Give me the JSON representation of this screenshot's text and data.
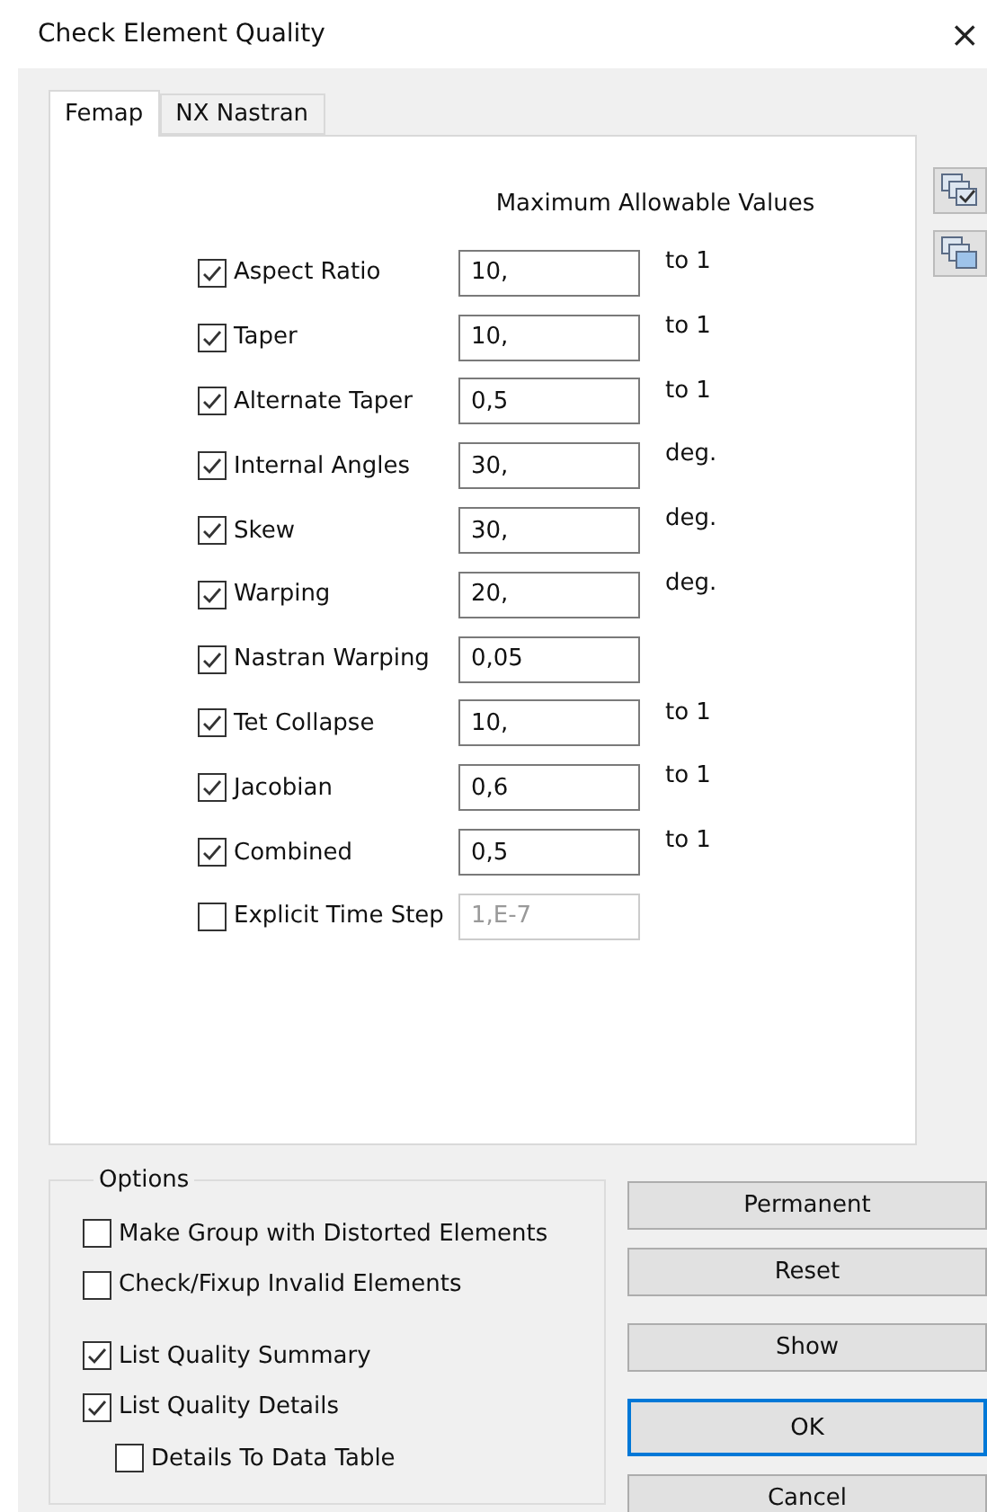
{
  "window": {
    "title": "Check Element Quality",
    "close": "×"
  },
  "tabs": [
    {
      "label": "Femap",
      "selected": true
    },
    {
      "label": "NX Nastran",
      "selected": false
    }
  ],
  "heading": "Maximum Allowable Values",
  "criteria": [
    {
      "label": "Aspect Ratio",
      "checked": true,
      "value": "10,",
      "unit": "to 1",
      "disabled": false
    },
    {
      "label": "Taper",
      "checked": true,
      "value": "10,",
      "unit": "to 1",
      "disabled": false
    },
    {
      "label": "Alternate Taper",
      "checked": true,
      "value": "0,5",
      "unit": "to 1",
      "disabled": false
    },
    {
      "label": "Internal Angles",
      "checked": true,
      "value": "30,",
      "unit": "deg.",
      "disabled": false
    },
    {
      "label": "Skew",
      "checked": true,
      "value": "30,",
      "unit": "deg.",
      "disabled": false
    },
    {
      "label": "Warping",
      "checked": true,
      "value": "20,",
      "unit": "deg.",
      "disabled": false
    },
    {
      "label": "Nastran Warping",
      "checked": true,
      "value": "0,05",
      "disabled": false
    },
    {
      "label": "Tet Collapse",
      "checked": true,
      "value": "10,",
      "unit": "to 1",
      "disabled": false
    },
    {
      "label": "Jacobian",
      "checked": true,
      "value": "0,6",
      "unit": "to 1",
      "disabled": false
    },
    {
      "label": "Combined",
      "checked": true,
      "value": "0,5",
      "unit": "to 1",
      "disabled": false
    },
    {
      "label": "Explicit Time Step",
      "checked": false,
      "value": "1,E-7",
      "disabled": true
    }
  ],
  "options": {
    "title": "Options",
    "items": [
      {
        "label": "Make Group with Distorted Elements",
        "checked": false,
        "gap_before": false,
        "indented": false
      },
      {
        "label": "Check/Fixup Invalid Elements",
        "checked": false,
        "gap_before": false,
        "indented": false
      },
      {
        "label": "List Quality Summary",
        "checked": true,
        "gap_before": true,
        "indented": false
      },
      {
        "label": "List Quality Details",
        "checked": true,
        "gap_before": false,
        "indented": false
      },
      {
        "label": "Details To Data Table",
        "checked": false,
        "gap_before": false,
        "indented": true
      }
    ]
  },
  "button_groups": [
    [
      {
        "label": "Permanent",
        "default": false
      },
      {
        "label": "Reset",
        "default": false
      }
    ],
    [
      {
        "label": "Show",
        "default": false
      }
    ],
    [
      {
        "label": "OK",
        "default": true
      },
      {
        "label": "Cancel",
        "default": false
      }
    ]
  ]
}
